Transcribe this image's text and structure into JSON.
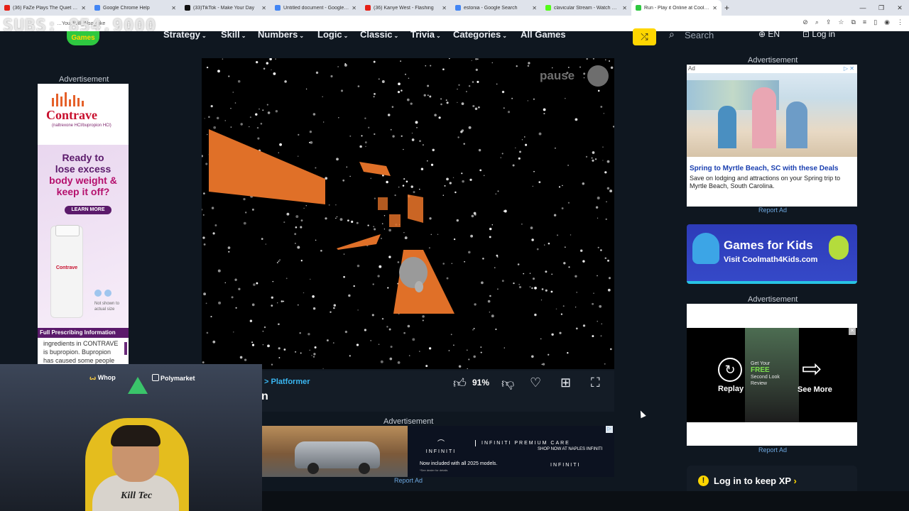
{
  "browser": {
    "tabs": [
      {
        "title": "(36) FaZe Plays The Quiet Place",
        "color": "#e62117"
      },
      {
        "title": "Google Chrome Help",
        "color": "#4285f4"
      },
      {
        "title": "(33)TikTok - Make Your Day",
        "color": "#111111"
      },
      {
        "title": "Untitled document - Google Docs",
        "color": "#4285f4"
      },
      {
        "title": "(36) Kanye West - Flashing",
        "color": "#e62117"
      },
      {
        "title": "estonia - Google Search",
        "color": "#4285f4"
      },
      {
        "title": "clavicular Stream - Watch Live",
        "color": "#53fc18"
      },
      {
        "title": "Run - Play it Online at Coolmath",
        "color": "#2ec840",
        "active": true
      }
    ],
    "new_tab": "+",
    "window_controls": [
      "—",
      "❐",
      "✕"
    ],
    "url_fragment": "…You_Will_Also_Like"
  },
  "overlay": {
    "subs_text": "SUBS: 854,9000"
  },
  "site": {
    "logo_text": "Games",
    "nav": [
      "Strategy",
      "Skill",
      "Numbers",
      "Logic",
      "Classic",
      "Trivia",
      "Categories",
      "All Games"
    ],
    "search_placeholder": "Search",
    "language": "EN",
    "login": "Log in"
  },
  "ads": {
    "label": "Advertisement",
    "report": "Report Ad",
    "left": {
      "brand": "Contrave",
      "generic": "(naltrexone HCl/bupropion HCl)",
      "headline_1": "Ready to",
      "headline_2": "lose excess",
      "headline_3": "body weight &",
      "headline_4": "keep it off?",
      "cta": "LEARN MORE",
      "bottle_label": "Contrave",
      "not_shown": "Not shown to actual size",
      "fpi": "Full Prescribing Information",
      "isi": "ingredients in CONTRAVE is bupropion. Bupropion has caused some people"
    },
    "bottom": {
      "brand": "INFINITI",
      "premium": "INFINITI PREMIUM CARE",
      "models": "Now included with all 2025 models.",
      "fine": "*See dealer for details",
      "shop": "SHOP NOW AT NAPLES INFINITI",
      "brand2": "INFINITI"
    },
    "right1": {
      "tag": "Ad",
      "headline": "Spring to Myrtle Beach, SC with these Deals",
      "body": "Save on lodging and attractions on your Spring trip to Myrtle Beach, South Carolina."
    },
    "kids": {
      "title": "Games for Kids",
      "subtitle": "Visit Coolmath4Kids.com"
    },
    "right3": {
      "replay": "Replay",
      "see_more": "See More",
      "mid_text_1": "Get Your",
      "mid_text_2": "FREE",
      "mid_text_3": "Second Look",
      "mid_text_4": "Review"
    }
  },
  "game": {
    "pause_label": "pause",
    "breadcrumb": "> Platformer",
    "title_fragment": "n",
    "rating": "91%",
    "colors": {
      "platform": "#e07028",
      "background": "#000000"
    }
  },
  "xp": {
    "label": "Log in to keep XP"
  },
  "webcam": {
    "sponsor1": "Whop",
    "sponsor2": "Polymarket",
    "hoodie": "Kill Tec"
  }
}
